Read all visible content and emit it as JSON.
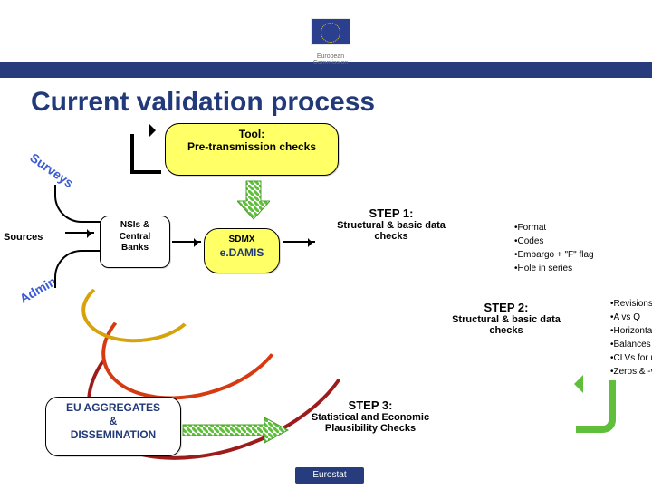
{
  "header": {
    "org_line1": "European",
    "org_line2": "Commission"
  },
  "title": "Current validation process",
  "tool": {
    "label": "Tool:",
    "body": "Pre-transmission checks"
  },
  "surveys": "Surveys",
  "admin": "Admin",
  "sources": "Sources",
  "nsi": {
    "l1": "NSIs &",
    "l2": "Central",
    "l3": "Banks"
  },
  "edamis": {
    "top": "SDMX",
    "main": "e.DAMIS"
  },
  "step1": {
    "name": "STEP 1:",
    "sub": "Structural & basic data checks",
    "bullets": [
      "Format",
      "Codes",
      "Embargo + \"F\" flag",
      "Hole in series"
    ]
  },
  "step2": {
    "name": "STEP 2:",
    "sub": "Structural & basic data checks",
    "bullets": [
      "Revisions",
      "A vs Q",
      "Horizontal checks",
      "Balances",
      "CLVs for ref year",
      "Zeros & -ve values"
    ]
  },
  "step3": {
    "name": "STEP 3:",
    "sub": "Statistical and Economic Plausibility Checks"
  },
  "euagg": {
    "l1": "EU AGGREGATES",
    "l2": "&",
    "l3": "DISSEMINATION"
  },
  "footer": "Eurostat"
}
